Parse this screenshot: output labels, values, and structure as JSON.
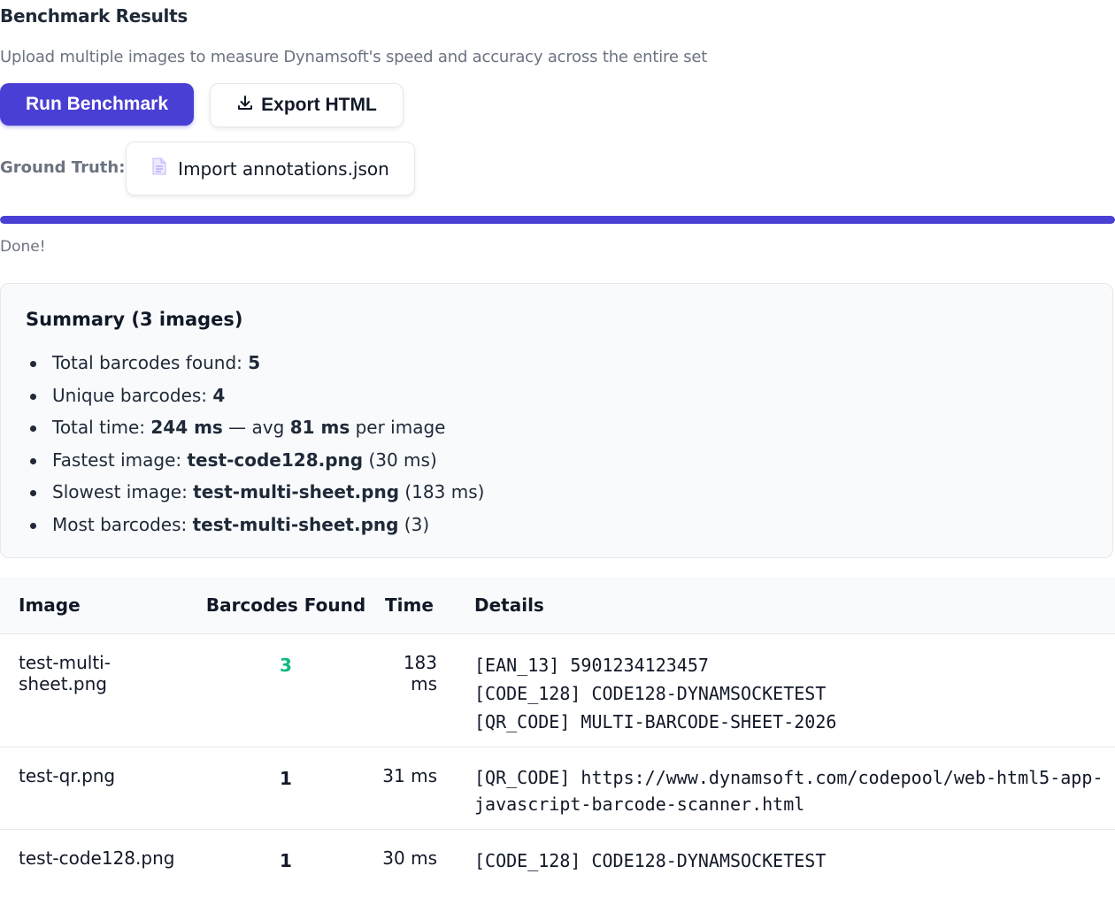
{
  "header": {
    "title": "Benchmark Results",
    "subtitle": "Upload multiple images to measure Dynamsoft's speed and accuracy across the entire set"
  },
  "toolbar": {
    "run_label": "Run Benchmark",
    "export_label": "Export HTML",
    "export_icon": "download-icon"
  },
  "ground_truth": {
    "label": "Ground Truth:",
    "import_label": "Import annotations.json",
    "import_icon": "file-icon"
  },
  "progress": {
    "fraction": 1.0,
    "status": "Done!",
    "color": "#4a3fd4"
  },
  "summary": {
    "title": "Summary (3 images)",
    "total_found_label": "Total barcodes found: ",
    "total_found": "5",
    "unique_label": "Unique barcodes: ",
    "unique": "4",
    "total_time_label": "Total time: ",
    "total_time": "244 ms",
    "avg_label": " — avg ",
    "avg_time": "81 ms",
    "avg_suffix": " per image",
    "fastest_label": "Fastest image: ",
    "fastest_name": "test-code128.png",
    "fastest_time": " (30 ms)",
    "slowest_label": "Slowest image: ",
    "slowest_name": "test-multi-sheet.png",
    "slowest_time": " (183 ms)",
    "most_label": "Most barcodes: ",
    "most_name": "test-multi-sheet.png",
    "most_count": " (3)"
  },
  "table": {
    "headers": [
      "Image",
      "Barcodes Found",
      "Time",
      "Details"
    ],
    "rows": [
      {
        "image": "test-multi-sheet.png",
        "count": "3",
        "time": "183 ms",
        "details": [
          "[EAN_13] 5901234123457",
          "[CODE_128] CODE128-DYNAMSOCKETEST",
          "[QR_CODE] MULTI-BARCODE-SHEET-2026"
        ]
      },
      {
        "image": "test-qr.png",
        "count": "1",
        "time": "31 ms",
        "details": [
          "[QR_CODE] https://www.dynamsoft.com/codepool/web-html5-app-",
          "javascript-barcode-scanner.html"
        ]
      },
      {
        "image": "test-code128.png",
        "count": "1",
        "time": "30 ms",
        "details": [
          "[CODE_128] CODE128-DYNAMSOCKETEST"
        ]
      }
    ],
    "highlight_color": "#10b981"
  }
}
